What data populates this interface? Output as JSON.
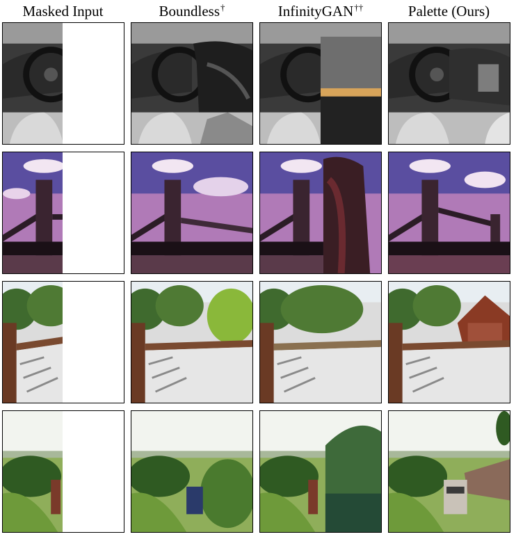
{
  "headers": [
    {
      "label": "Masked Input",
      "mark": ""
    },
    {
      "label": "Boundless",
      "mark": "†"
    },
    {
      "label": "InfinityGAN",
      "mark": "††"
    },
    {
      "label": "Palette (Ours)",
      "mark": ""
    }
  ],
  "rows": [
    "car-interior",
    "tower-bridge",
    "bridge-path",
    "train-landscape"
  ],
  "columns": [
    "masked-input",
    "boundless",
    "infinitygan",
    "palette"
  ]
}
